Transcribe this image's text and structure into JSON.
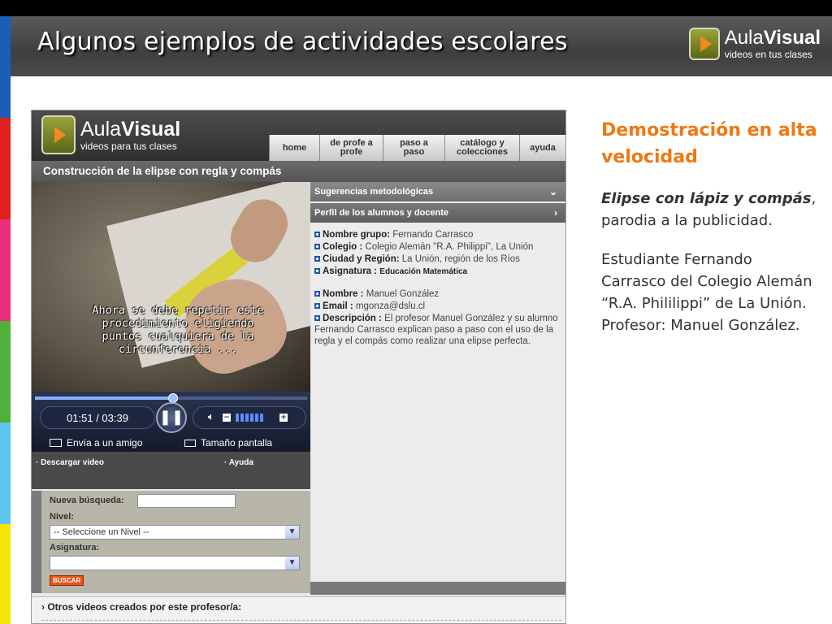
{
  "slide": {
    "title": "Algunos ejemplos de actividades escolares",
    "logo": {
      "word1": "Aula",
      "word2": "Visual",
      "tagline": "videos en tus clases"
    },
    "strip_colors": [
      "#1a5eb8",
      "#e0201e",
      "#e8317a",
      "#4fb03a",
      "#5bc5ee",
      "#f6e500"
    ]
  },
  "site": {
    "logo": {
      "word1": "Aula",
      "word2": "Visual",
      "tagline": "videos para tus clases"
    },
    "nav": [
      {
        "label": "home"
      },
      {
        "label": "de profe a profe"
      },
      {
        "label": "paso a paso"
      },
      {
        "label": "catálogo y colecciones"
      },
      {
        "label": "ayuda"
      }
    ],
    "video_title": "Construcción de la elipse con regla y compás",
    "video": {
      "caption": "Ahora se debe repetir este\nprocedimiento eligiendo\npuntos cualquiera de la\ncircunferencia ...",
      "time": "01:51 / 03:39",
      "progress": 0.506,
      "volume_bars": 6,
      "send_label": "Envía a un amigo",
      "size_label": "Tamaño pantalla"
    },
    "links": {
      "download": "· Descargar video",
      "help": "· Ayuda"
    },
    "search": {
      "new_search_label": "Nueva búsqueda:",
      "level_label": "Nivel:",
      "level_value": "-- Seleccione un Nivel --",
      "subject_label": "Asignatura:",
      "subject_value": "",
      "button": "BUSCAR"
    },
    "panel": {
      "suggestions": "Sugerencias metodológicas",
      "profile": "Perfil de los alumnos y docente",
      "group_label": "Nombre grupo:",
      "group_value": "Fernando Carrasco",
      "school_label": "Colegio :",
      "school_value": "Colegio Alemán \"R.A. Philippi\", La Unión",
      "city_label": "Ciudad y Región:",
      "city_value": "La Unión, región de los Ríos",
      "subject_label": "Asignatura :",
      "subject_value": "Educación Matemática",
      "name_label": "Nombre :",
      "name_value": "Manuel González",
      "email_label": "Email :",
      "email_value": "mgonza@dslu.cl",
      "desc_label": "Descripción :",
      "desc_value": "El profesor Manuel González y su alumno Fernando Carrasco explican paso a paso con el uso de la regla y el compás como realizar una elipse perfecta."
    },
    "others": "Otros videos creados por este profesor/a:"
  },
  "side_text": {
    "heading": "Demostración en alta velocidad",
    "p1_em": "Elipse con lápiz y compás",
    "p1_rest": ", parodia a la publicidad.",
    "p2": "Estudiante Fernando Carrasco del Colegio Alemán “R.A. Phililippi” de La Unión. Profesor: Manuel González."
  }
}
